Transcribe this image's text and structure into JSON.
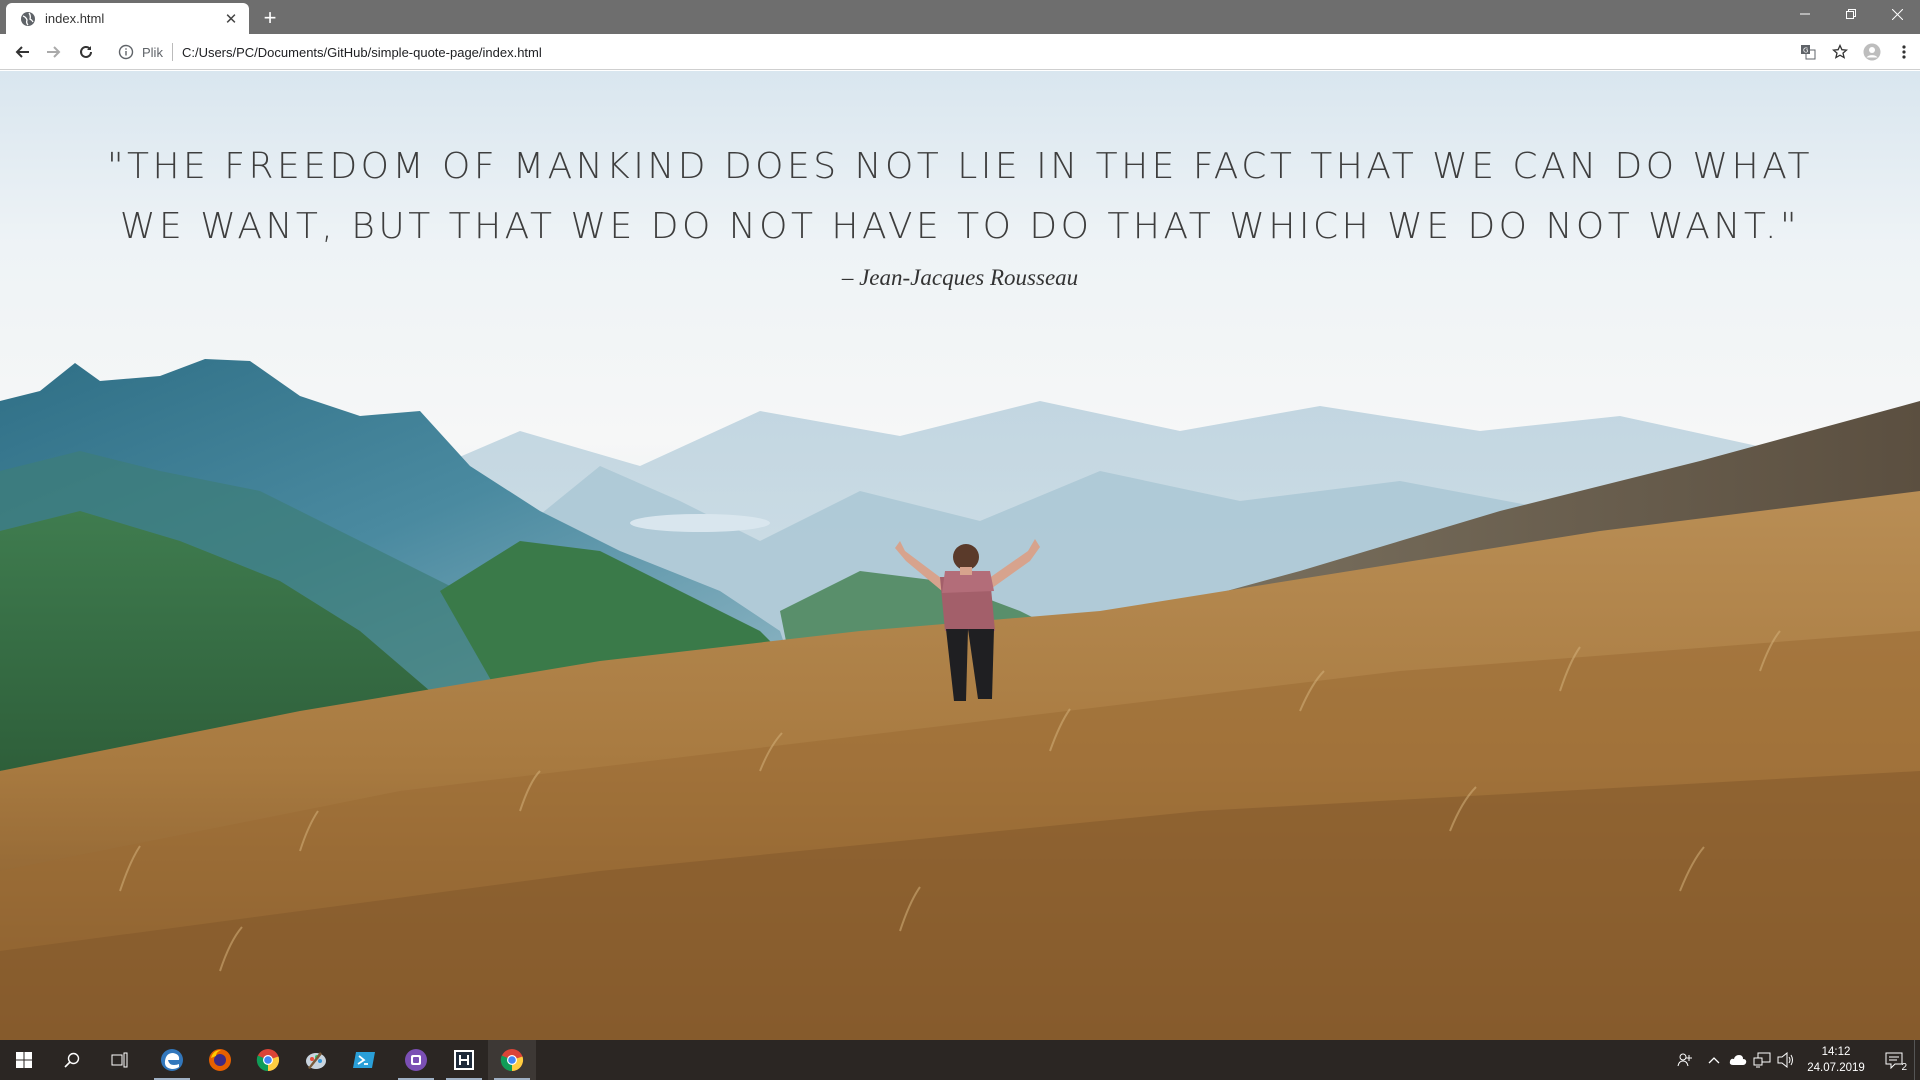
{
  "browser": {
    "tab": {
      "title": "index.html"
    },
    "address_bar": {
      "scheme_label": "Plik",
      "url": "C:/Users/PC/Documents/GitHub/simple-quote-page/index.html"
    }
  },
  "page": {
    "quote": "\"The freedom of mankind does not lie in the fact that we can do what we want, but that we do not have to do that which we do not want.\"",
    "author": "– Jean-Jacques Rousseau"
  },
  "taskbar": {
    "apps": [
      "start-icon",
      "search-icon",
      "task-view-icon",
      "edge-icon",
      "firefox-icon",
      "chrome-icon",
      "paint-icon",
      "powershell-icon",
      "visual-studio-icon",
      "unity-icon",
      "chrome-icon"
    ],
    "clock": {
      "time": "14:12",
      "date": "24.07.2019"
    },
    "notification_count": "2"
  },
  "colors": {
    "tab_strip": "#6e6e6e",
    "taskbar": "#2b2623",
    "quote_text": "#3e3e3e"
  }
}
